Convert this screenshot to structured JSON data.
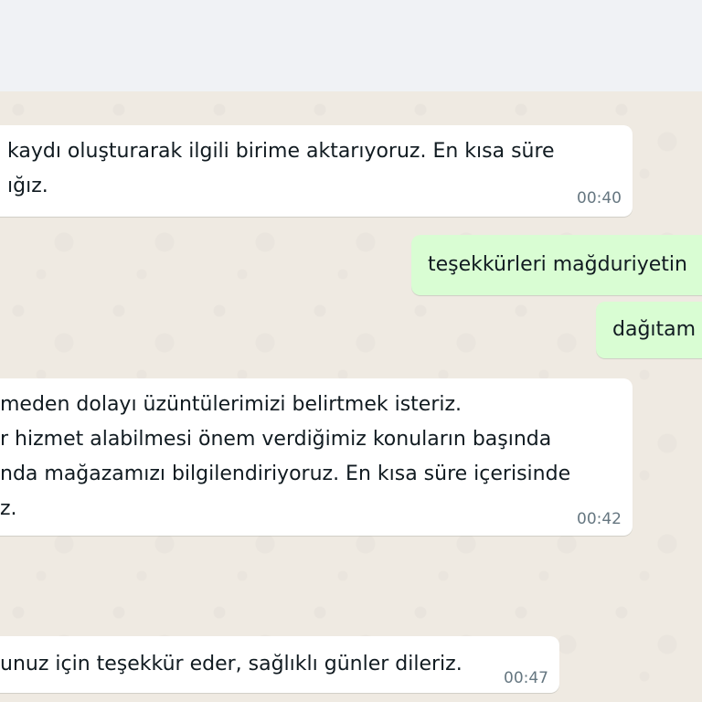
{
  "messages": [
    {
      "direction": "incoming",
      "lines": [
        "kaydı oluşturarak ilgili birime aktarıyoruz. En kısa süre",
        "ığız."
      ],
      "time": "00:40"
    },
    {
      "direction": "outgoing",
      "lines": [
        "teşekkürleri mağduriyetin"
      ],
      "time": ""
    },
    {
      "direction": "outgoing",
      "lines": [
        "dağıtam"
      ],
      "time": ""
    },
    {
      "direction": "incoming",
      "lines": [
        "meden dolayı üzüntülerimizi belirtmek isteriz.",
        "r hizmet alabilmesi önem verdiğimiz konuların başında",
        "nda mağazamızı bilgilendiriyoruz. En kısa süre içerisinde",
        "z."
      ],
      "time": "00:42"
    },
    {
      "direction": "incoming",
      "lines": [
        "unuz için teşekkür eder, sağlıklı günler dileriz."
      ],
      "time": "00:47"
    }
  ]
}
